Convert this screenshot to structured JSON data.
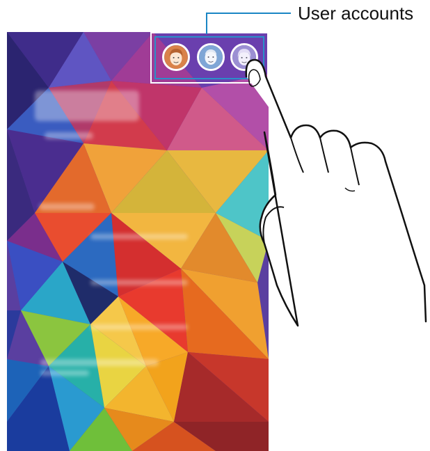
{
  "callout": {
    "label": "User accounts"
  },
  "accounts": [
    {
      "name": "user-1",
      "color": "#d9824a"
    },
    {
      "name": "user-2",
      "color": "#7fa6d6"
    },
    {
      "name": "user-3",
      "color": "#9b8fd3"
    }
  ],
  "colors": {
    "highlight_border": "#2a8fc9",
    "wallpaper_primary": "#e0a020"
  }
}
